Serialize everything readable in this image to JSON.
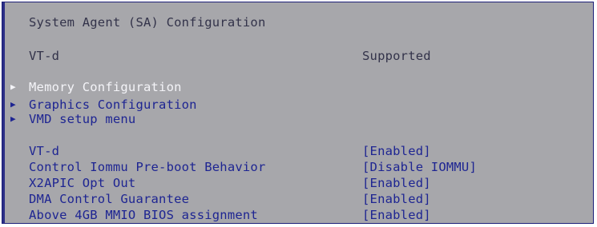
{
  "page_title": "System Agent (SA) Configuration",
  "info": {
    "label": "VT-d",
    "value": "Supported"
  },
  "submenus": [
    {
      "label": "Memory Configuration",
      "selected": true
    },
    {
      "label": "Graphics Configuration",
      "selected": false
    },
    {
      "label": "VMD setup menu",
      "selected": false
    }
  ],
  "settings": [
    {
      "label": "VT-d",
      "value": "[Enabled]"
    },
    {
      "label": "Control Iommu Pre-boot Behavior",
      "value": "[Disable IOMMU]"
    },
    {
      "label": "X2APIC Opt Out",
      "value": "[Enabled]"
    },
    {
      "label": "DMA Control Guarantee",
      "value": "[Enabled]"
    },
    {
      "label": "Above 4GB MMIO BIOS assignment",
      "value": "[Enabled]"
    }
  ],
  "colors": {
    "background": "#a7a7ab",
    "text_dark": "#33334a",
    "text_blue": "#1e2592",
    "text_selected": "#f4f4f8"
  },
  "icons": {
    "submenu_marker": "triangle-right-icon"
  }
}
